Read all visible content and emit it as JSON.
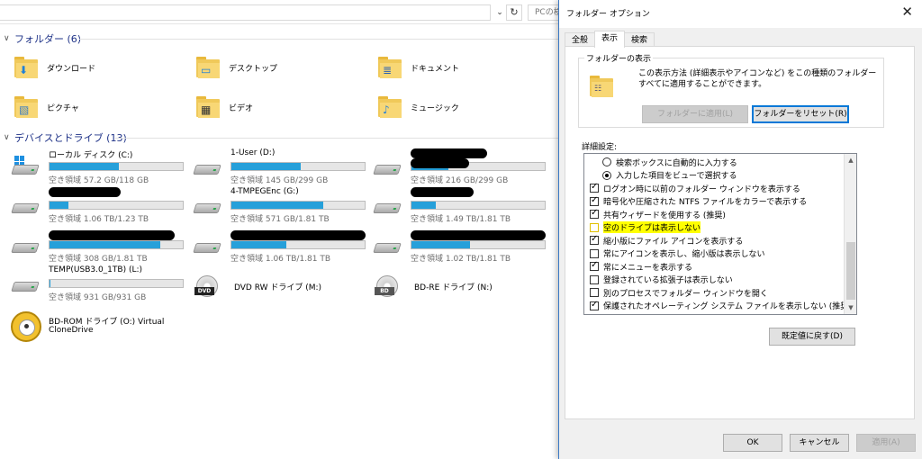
{
  "explorer": {
    "search_placeholder": "PCの検",
    "folders_header": "フォルダー (6)",
    "folders": [
      {
        "label": "ダウンロード",
        "icon": "downloads-folder-icon",
        "glyph": "⬇"
      },
      {
        "label": "デスクトップ",
        "icon": "desktop-folder-icon",
        "glyph": "▭"
      },
      {
        "label": "ドキュメント",
        "icon": "documents-folder-icon",
        "glyph": "≣"
      },
      {
        "label": "ピクチャ",
        "icon": "pictures-folder-icon",
        "glyph": "▧"
      },
      {
        "label": "ビデオ",
        "icon": "videos-folder-icon",
        "glyph": "▦"
      },
      {
        "label": "ミュージック",
        "icon": "music-folder-icon",
        "glyph": "♪"
      }
    ],
    "drives_header": "デバイスとドライブ (13)",
    "drives": [
      {
        "name": "ローカル ディスク (C:)",
        "free": "空き領域 57.2 GB/118 GB",
        "fill": 0.52
      },
      {
        "name": "1-User (D:)",
        "free": "空き領域 145 GB/299 GB",
        "fill": 0.52
      },
      {
        "name": "",
        "free": "空き領域 216 GB/299 GB",
        "fill": 0.28
      },
      {
        "name": "",
        "free": "空き領域 1.06 TB/1.23 TB",
        "fill": 0.14
      },
      {
        "name": "4-TMPEGEnc (G:)",
        "free": "空き領域 571 GB/1.81 TB",
        "fill": 0.69
      },
      {
        "name": "",
        "free": "空き領域 1.49 TB/1.81 TB",
        "fill": 0.18
      },
      {
        "name": "",
        "free": "空き領域 308 GB/1.81 TB",
        "fill": 0.83
      },
      {
        "name": "",
        "free": "空き領域 1.06 TB/1.81 TB",
        "fill": 0.41
      },
      {
        "name": "",
        "free": "空き領域 1.02 TB/1.81 TB",
        "fill": 0.44
      },
      {
        "name": "TEMP(USB3.0_1TB) (L:)",
        "free": "空き領域 931 GB/931 GB",
        "fill": 0.01
      }
    ],
    "optical": [
      {
        "name": "DVD RW ドライブ (M:)",
        "tag": "DVD"
      },
      {
        "name": "BD-RE ドライブ (N:)",
        "tag": "BD"
      }
    ],
    "virtual_drive": {
      "line1": "BD-ROM ドライブ (O:) Virtual",
      "line2": "CloneDrive"
    }
  },
  "dialog": {
    "title": "フォルダー オプション",
    "tabs": [
      "全般",
      "表示",
      "検索"
    ],
    "active_tab": "表示",
    "folder_view": {
      "legend": "フォルダーの表示",
      "description": "この表示方法 (詳細表示やアイコンなど) をこの種類のフォルダーすべてに適用することができます。",
      "apply_button": "フォルダーに適用(L)",
      "reset_button": "フォルダーをリセット(R)"
    },
    "advanced_label": "詳細設定:",
    "advanced_items": [
      {
        "kind": "radio",
        "checked": false,
        "label": "検索ボックスに自動的に入力する",
        "indent": 1,
        "highlight": false
      },
      {
        "kind": "radio",
        "checked": true,
        "label": "入力した項目をビューで選択する",
        "indent": 1,
        "highlight": false
      },
      {
        "kind": "check",
        "checked": true,
        "label": "ログオン時に以前のフォルダー ウィンドウを表示する",
        "indent": 0,
        "highlight": false
      },
      {
        "kind": "check",
        "checked": true,
        "label": "暗号化や圧縮された NTFS ファイルをカラーで表示する",
        "indent": 0,
        "highlight": false
      },
      {
        "kind": "check",
        "checked": true,
        "label": "共有ウィザードを使用する (推奨)",
        "indent": 0,
        "highlight": false
      },
      {
        "kind": "check",
        "checked": false,
        "label": "空のドライブは表示しない",
        "indent": 0,
        "highlight": true
      },
      {
        "kind": "check",
        "checked": true,
        "label": "縮小版にファイル アイコンを表示する",
        "indent": 0,
        "highlight": false
      },
      {
        "kind": "check",
        "checked": false,
        "label": "常にアイコンを表示し、縮小版は表示しない",
        "indent": 0,
        "highlight": false
      },
      {
        "kind": "check",
        "checked": true,
        "label": "常にメニューを表示する",
        "indent": 0,
        "highlight": false
      },
      {
        "kind": "check",
        "checked": false,
        "label": "登録されている拡張子は表示しない",
        "indent": 0,
        "highlight": false
      },
      {
        "kind": "check",
        "checked": false,
        "label": "別のプロセスでフォルダー ウィンドウを開く",
        "indent": 0,
        "highlight": false
      },
      {
        "kind": "check",
        "checked": true,
        "label": "保護されたオペレーティング システム ファイルを表示しない (推奨)",
        "indent": 0,
        "highlight": false
      }
    ],
    "restore_button": "既定値に戻す(D)",
    "ok_button": "OK",
    "cancel_button": "キャンセル",
    "apply_button": "適用(A)"
  },
  "colors": {
    "accent": "#0078d7",
    "progress": "#26a0da",
    "group_header": "#1e3287",
    "highlight": "#ffff00"
  }
}
